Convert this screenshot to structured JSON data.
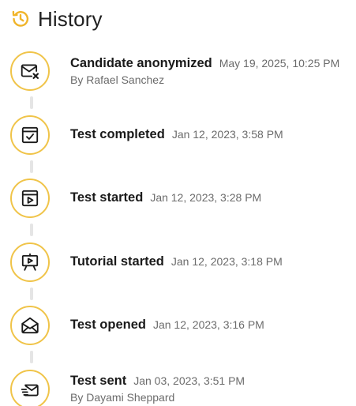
{
  "header": {
    "title": "History",
    "icon": "history-icon",
    "accent_color": "#f0b429"
  },
  "events": [
    {
      "title": "Candidate anonymized",
      "timestamp": "May 19, 2025, 10:25 PM",
      "by": "By Rafael Sanchez",
      "icon": "envelope-x-icon"
    },
    {
      "title": "Test completed",
      "timestamp": "Jan 12, 2023, 3:58 PM",
      "icon": "window-check-icon"
    },
    {
      "title": "Test started",
      "timestamp": "Jan 12, 2023, 3:28 PM",
      "icon": "window-play-icon"
    },
    {
      "title": "Tutorial started",
      "timestamp": "Jan 12, 2023, 3:18 PM",
      "icon": "presentation-easel-icon"
    },
    {
      "title": "Test opened",
      "timestamp": "Jan 12, 2023, 3:16 PM",
      "icon": "envelope-open-icon"
    },
    {
      "title": "Test sent",
      "timestamp": "Jan 03, 2023, 3:51 PM",
      "by": "By Dayami Sheppard",
      "icon": "envelope-send-icon"
    }
  ]
}
